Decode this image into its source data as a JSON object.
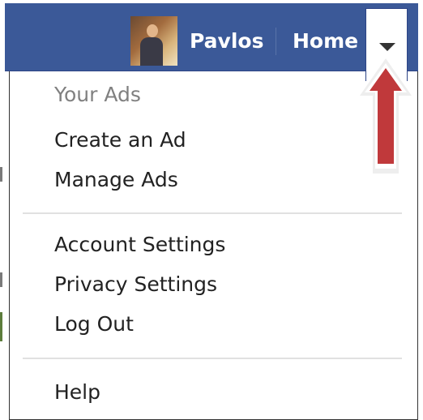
{
  "header": {
    "user_name": "Pavlos",
    "home_label": "Home",
    "background_color": "#3b5998"
  },
  "account_menu": {
    "sections": [
      {
        "header": "Your Ads",
        "items": [
          "Create an Ad",
          "Manage Ads"
        ]
      },
      {
        "items": [
          "Account Settings",
          "Privacy Settings",
          "Log Out"
        ]
      },
      {
        "items": [
          "Help"
        ]
      }
    ]
  },
  "icons": {
    "dropdown": "chevron-down-icon",
    "annotation": "up-arrow-icon"
  },
  "annotation": {
    "arrow_color": "#c0393b"
  }
}
